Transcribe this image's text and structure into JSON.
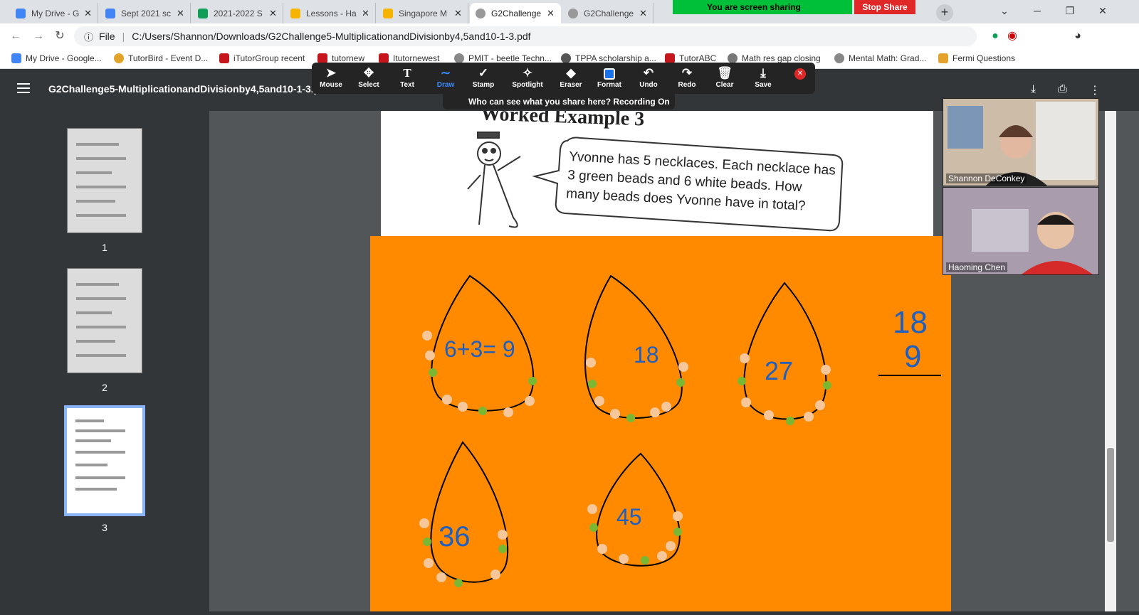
{
  "tabs": [
    {
      "title": "My Drive - G",
      "color": "#4285f4"
    },
    {
      "title": "Sept 2021 sc",
      "color": "#4285f4"
    },
    {
      "title": "2021-2022 S",
      "color": "#0f9d58"
    },
    {
      "title": "Lessons - Ha",
      "color": "#f4b400"
    },
    {
      "title": "Singapore M",
      "color": "#f4b400"
    },
    {
      "title": "G2Challenge",
      "color": "#999999"
    },
    {
      "title": "G2Challenge",
      "color": "#999999"
    }
  ],
  "share": {
    "banner": "You are screen sharing",
    "stop": "Stop Share"
  },
  "address": {
    "scheme": "File",
    "url": "C:/Users/Shannon/Downloads/G2Challenge5-MultiplicationandDivisionby4,5and10-1-3.pdf"
  },
  "bookmarks": [
    "My Drive - Google...",
    "TutorBird - Event D...",
    "iTutorGroup recent",
    "tutornew",
    "Itutornewest",
    "PMIT - beetle Techn...",
    "TPPA scholarship a...",
    "TutorABC",
    "Math res gap closing",
    "Mental Math: Grad...",
    "Fermi Questions"
  ],
  "pdf": {
    "filename": "G2Challenge5-MultiplicationandDivisionby4,5and10-1-3.pdf"
  },
  "tools": [
    "Mouse",
    "Select",
    "Text",
    "Draw",
    "Stamp",
    "Spotlight",
    "Eraser",
    "Format",
    "Undo",
    "Redo",
    "Clear",
    "Save"
  ],
  "recording": "Who can see what you share here? Recording On",
  "thumbnails": [
    "1",
    "2",
    "3"
  ],
  "worksheet": {
    "heading": "Worked Example 3",
    "bubble_lines": [
      "Yvonne has 5 necklaces. Each necklace has",
      "3 green beads and 6 white beads. How",
      "many beads does Yvonne have in total?"
    ]
  },
  "drawings": {
    "labels": [
      "6+3= 9",
      "18",
      "27",
      "36",
      "45"
    ],
    "side_top": "18",
    "side_bottom": "9"
  },
  "participants": [
    "Shannon DeConkey",
    "Haoming Chen"
  ],
  "colors": {
    "share_green": "#00c03a",
    "stop_red": "#e02828",
    "orange_board": "#ff8a00",
    "ink_blue": "#1f5fbf"
  }
}
